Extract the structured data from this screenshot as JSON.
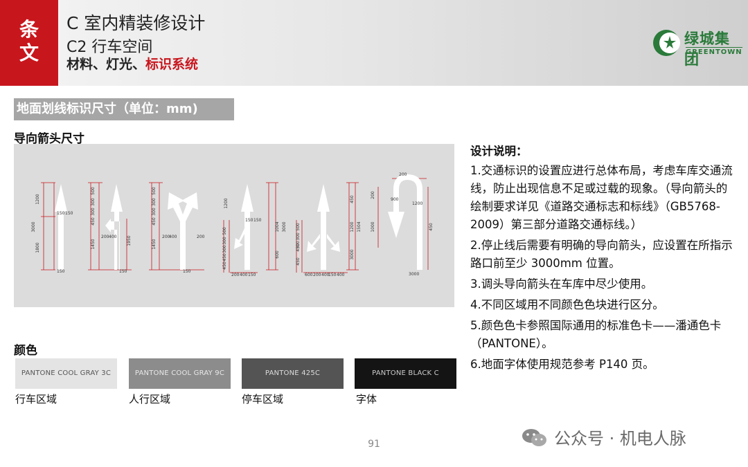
{
  "header": {
    "tag_chars": [
      "条",
      "文"
    ],
    "title": "C 室内精装修设计",
    "subtitle": "C2 行车空间",
    "tags_normal": "材料、灯光、",
    "tags_highlight": "标识系统",
    "accent_color": "#c8161d"
  },
  "logo": {
    "name": "绿城集团",
    "en": "GREENTOWN",
    "color": "#2a7a3a"
  },
  "section": {
    "title": "地面划线标识尺寸（单位：mm)",
    "subtitle": "导向箭头尺寸"
  },
  "diagram": {
    "labels": [
      "1200",
      "1800",
      "3000",
      "150",
      "150",
      "150",
      "500",
      "300",
      "300",
      "450",
      "1450",
      "200",
      "400",
      "1950",
      "150",
      "500",
      "300",
      "300",
      "450",
      "1450",
      "200",
      "400",
      "200",
      "150",
      "500",
      "300",
      "300",
      "450",
      "450",
      "200",
      "400",
      "150",
      "150",
      "150",
      "1200",
      "1004",
      "3000",
      "600",
      "450",
      "500",
      "300",
      "300",
      "450",
      "450",
      "1200",
      "1504",
      "3000",
      "600",
      "200",
      "400",
      "150",
      "400",
      "200",
      "900",
      "200",
      "1000",
      "1200",
      "450",
      "3000",
      "200"
    ]
  },
  "colors": {
    "heading": "颜色",
    "swatches": [
      {
        "name": "PANTONE COOL GRAY 3C",
        "label": "行车区域",
        "bg": "#e4e4e4",
        "fg": "#555555"
      },
      {
        "name": "PANTONE COOL GRAY 9C",
        "label": "人行区域",
        "bg": "#8c8c8c",
        "fg": "#e8e8e8"
      },
      {
        "name": "PANTONE 425C",
        "label": "停车区域",
        "bg": "#545454",
        "fg": "#dddddd"
      },
      {
        "name": "PANTONE BLACK C",
        "label": "字体",
        "bg": "#141414",
        "fg": "#cccccc"
      }
    ]
  },
  "notes": {
    "heading": "设计说明：",
    "items": [
      "1.交通标识的设置应进行总体布局，考虑车库交通流线，防止出现信息不足或过载的现象。（导向箭头的绘制要求详见《道路交通标志和标线》（GB5768-2009）第三部分道路交通标线。）",
      "2.停止线后需要有明确的导向箭头，应设置在所指示路口前至少 3000mm 位置。",
      "3.调头导向箭头在车库中尽少使用。",
      "4.不同区域用不同颜色色块进行区分。",
      "5.颜色色卡参照国际通用的标准色卡——潘通色卡（PANTONE）。",
      "6.地面字体使用规范参考 P140 页。"
    ]
  },
  "page_number": "91",
  "watermark": "公众号 · 机电人脉"
}
